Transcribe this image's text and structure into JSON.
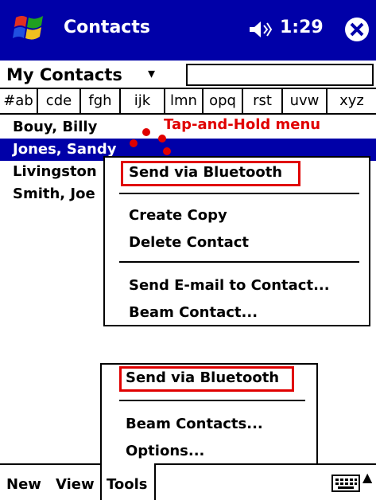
{
  "titlebar": {
    "app_title": "Contacts",
    "time": "1:29"
  },
  "filter": {
    "category": "My Contacts",
    "search_value": ""
  },
  "tabs": [
    "#ab",
    "cde",
    "fgh",
    "ijk",
    "lmn",
    "opq",
    "rst",
    "uvw",
    "xyz"
  ],
  "contacts": [
    "Bouy, Billy",
    "Jones, Sandy",
    "Livingston",
    "Smith, Joe"
  ],
  "annotation": "Tap-and-Hold menu",
  "context_menu": {
    "send_bluetooth": "Send via Bluetooth",
    "create_copy": "Create Copy",
    "delete_contact": "Delete Contact",
    "send_email": "Send E-mail to Contact...",
    "beam_contact": "Beam Contact..."
  },
  "tools_menu": {
    "send_bluetooth": "Send via Bluetooth",
    "beam_contacts": "Beam Contacts...",
    "options": "Options..."
  },
  "menubar": {
    "new": "New",
    "view": "View",
    "tools": "Tools"
  },
  "colors": {
    "titlebar": "#0000a8",
    "highlight": "#e00000",
    "selection": "#0000a8"
  }
}
